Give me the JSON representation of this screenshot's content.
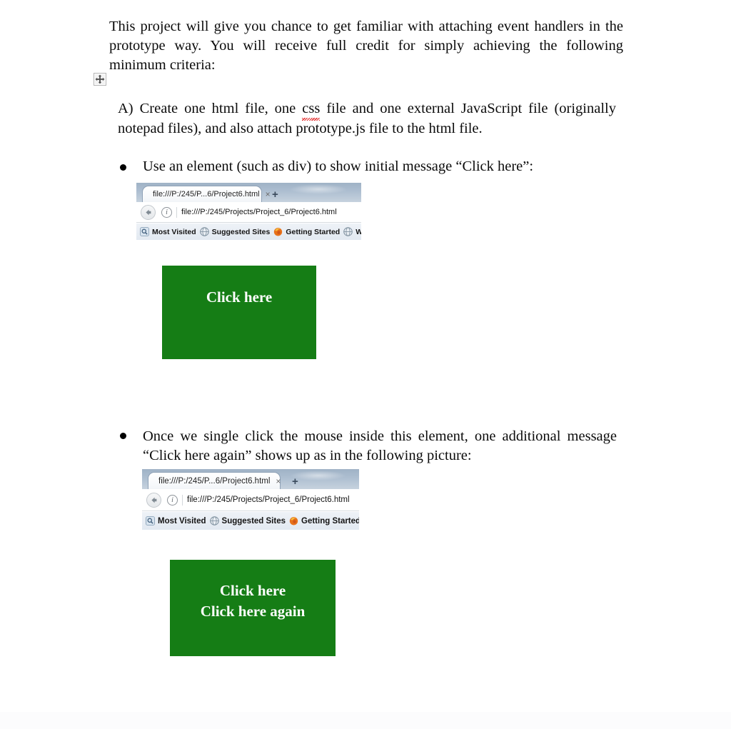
{
  "document": {
    "intro_paragraph": "This project will give you chance to get familiar with attaching event handlers in the prototype way. You will receive full credit for simply achieving the following minimum criteria:",
    "criteria": {
      "prefix": "A) Create one html file, one ",
      "misspelled_word": "css",
      "suffix": " file and one external JavaScript file (originally notepad files), and also attach prototype.js file to the html file."
    },
    "bullet_1": "Use an element (such as div) to show initial message “Click here”:",
    "bullet_2": "Once we single click the mouse inside this element, one additional message “Click here again” shows up as in the following picture:",
    "move_handle_icon": "move-four-arrows-icon"
  },
  "browser_1": {
    "tab": {
      "title": "file:///P:/245/P...6/Project6.html",
      "close_icon": "×",
      "new_tab_icon": "+"
    },
    "navbar": {
      "back_icon": "back-arrow-icon",
      "info_icon": "i",
      "url": "file:///P:/245/Projects/Project_6/Project6.html"
    },
    "bookmarks": [
      {
        "label": "Most Visited",
        "icon": "magnifier-icon"
      },
      {
        "label": "Suggested Sites",
        "icon": "globe-icon"
      },
      {
        "label": "Getting Started",
        "icon": "firefox-icon"
      },
      {
        "label": "Web Sli",
        "icon": "globe-icon"
      }
    ]
  },
  "browser_2": {
    "tab": {
      "title": "file:///P:/245/P...6/Project6.html",
      "close_icon": "×",
      "new_tab_icon": "+"
    },
    "navbar": {
      "back_icon": "back-arrow-icon",
      "info_icon": "i",
      "url": "file:///P:/245/Projects/Project_6/Project6.html"
    },
    "bookmarks": [
      {
        "label": "Most Visited",
        "icon": "magnifier-icon"
      },
      {
        "label": "Suggested Sites",
        "icon": "globe-icon"
      },
      {
        "label": "Getting Started",
        "icon": "firefox-icon"
      },
      {
        "label": "",
        "icon": "globe-icon"
      }
    ]
  },
  "green_box_1": {
    "line_1": "Click here",
    "background_color": "#157d15",
    "text_color": "#ffffff"
  },
  "green_box_2": {
    "line_1": "Click here",
    "line_2": "Click here again",
    "background_color": "#157d15",
    "text_color": "#ffffff"
  }
}
